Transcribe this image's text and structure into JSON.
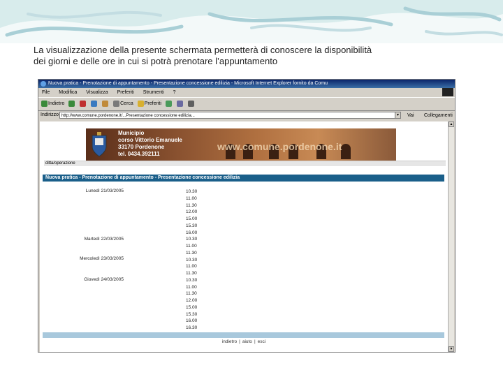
{
  "caption": {
    "line1": "La visualizzazione della presente schermata permetterà di conoscere la disponibilità",
    "line2": "dei giorni e delle ore in cui si potrà prenotare l’appuntamento"
  },
  "browser": {
    "title": "Nuova pratica - Prenotazione di appuntamento - Presentazione concessione edilizia - Microsoft Internet Explorer fornito da Comu",
    "menu": [
      "File",
      "Modifica",
      "Visualizza",
      "Preferiti",
      "Strumenti",
      "?"
    ],
    "toolbar": [
      "Indietro",
      "Cerca",
      "Preferiti"
    ],
    "address_label": "Indirizzo",
    "address_value": "http://www.comune.pordenone.it/...Presentazione concessione edilizia...",
    "go_label": "Vai",
    "links_label": "Collegamenti"
  },
  "site": {
    "banner": {
      "name": "Municipio",
      "street": "corso Vittorio Emanuele",
      "city": "33170 Pordenone",
      "phone": "tel. 0434.392111",
      "url": "www.comune.pordenone.it"
    },
    "breadcrumb": "ditta/operazione",
    "heading": "Nuova pratica - Prenotazione di appuntamento - Presentazione concessione edilizia",
    "days": [
      "Lunedì 21/03/2005",
      "Martedì 22/03/2005",
      "Mercoledì 23/03/2005",
      "Giovedì 24/03/2005"
    ],
    "slots": [
      "10.30",
      "11.00",
      "11.30",
      "12.00",
      "15.00",
      "15.30",
      "16.00",
      "10.30",
      "11.00",
      "11.30",
      "10.30",
      "11.00",
      "11.30",
      "10.30",
      "11.00",
      "11.30",
      "12.00",
      "15.00",
      "15.30",
      "16.00",
      "16.30"
    ],
    "footer_links": [
      "indietro",
      "aiuto",
      "esci"
    ]
  }
}
